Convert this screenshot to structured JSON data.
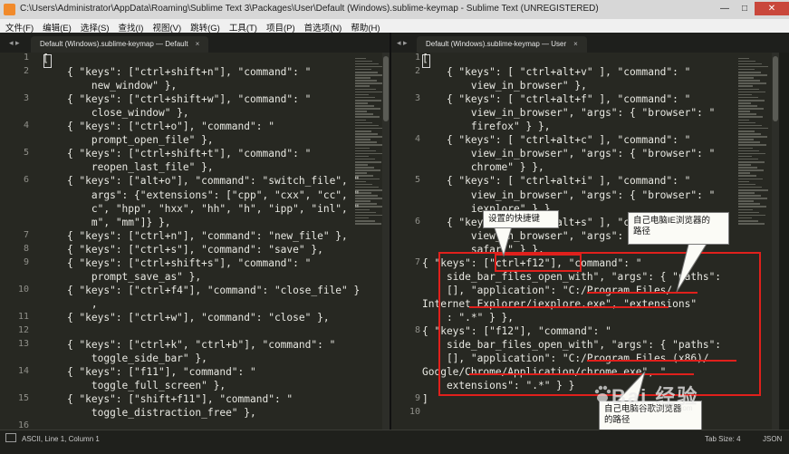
{
  "window": {
    "title": "C:\\Users\\Administrator\\AppData\\Roaming\\Sublime Text 3\\Packages\\User\\Default (Windows).sublime-keymap - Sublime Text (UNREGISTERED)",
    "minimize": "—",
    "maximize": "□",
    "close": "✕"
  },
  "menu": [
    "文件(F)",
    "编辑(E)",
    "选择(S)",
    "查找(I)",
    "视图(V)",
    "跳转(G)",
    "工具(T)",
    "项目(P)",
    "首选项(N)",
    "帮助(H)"
  ],
  "left_tab": {
    "label": "Default (Windows).sublime-keymap — Default",
    "close": "×",
    "nav": "◂ ▸"
  },
  "right_tab": {
    "label": "Default (Windows).sublime-keymap — User",
    "close": "×",
    "nav": "◂ ▸"
  },
  "left_lines": [
    {
      "n": "1",
      "text": "["
    },
    {
      "n": "2",
      "text": "    { \"keys\": [\"ctrl+shift+n\"], \"command\": \""
    },
    {
      "n": "",
      "text": "        new_window\" },"
    },
    {
      "n": "3",
      "text": "    { \"keys\": [\"ctrl+shift+w\"], \"command\": \""
    },
    {
      "n": "",
      "text": "        close_window\" },"
    },
    {
      "n": "4",
      "text": "    { \"keys\": [\"ctrl+o\"], \"command\": \""
    },
    {
      "n": "",
      "text": "        prompt_open_file\" },"
    },
    {
      "n": "5",
      "text": "    { \"keys\": [\"ctrl+shift+t\"], \"command\": \""
    },
    {
      "n": "",
      "text": "        reopen_last_file\" },"
    },
    {
      "n": "6",
      "text": "    { \"keys\": [\"alt+o\"], \"command\": \"switch_file\", \""
    },
    {
      "n": "",
      "text": "        args\": {\"extensions\": [\"cpp\", \"cxx\", \"cc\", \""
    },
    {
      "n": "",
      "text": "        c\", \"hpp\", \"hxx\", \"hh\", \"h\", \"ipp\", \"inl\", \""
    },
    {
      "n": "",
      "text": "        m\", \"mm\"]} },"
    },
    {
      "n": "7",
      "text": "    { \"keys\": [\"ctrl+n\"], \"command\": \"new_file\" },"
    },
    {
      "n": "8",
      "text": "    { \"keys\": [\"ctrl+s\"], \"command\": \"save\" },"
    },
    {
      "n": "9",
      "text": "    { \"keys\": [\"ctrl+shift+s\"], \"command\": \""
    },
    {
      "n": "",
      "text": "        prompt_save_as\" },"
    },
    {
      "n": "10",
      "text": "    { \"keys\": [\"ctrl+f4\"], \"command\": \"close_file\" }"
    },
    {
      "n": "",
      "text": "        ,"
    },
    {
      "n": "11",
      "text": "    { \"keys\": [\"ctrl+w\"], \"command\": \"close\" },"
    },
    {
      "n": "12",
      "text": ""
    },
    {
      "n": "13",
      "text": "    { \"keys\": [\"ctrl+k\", \"ctrl+b\"], \"command\": \""
    },
    {
      "n": "",
      "text": "        toggle_side_bar\" },"
    },
    {
      "n": "14",
      "text": "    { \"keys\": [\"f11\"], \"command\": \""
    },
    {
      "n": "",
      "text": "        toggle_full_screen\" },"
    },
    {
      "n": "15",
      "text": "    { \"keys\": [\"shift+f11\"], \"command\": \""
    },
    {
      "n": "",
      "text": "        toggle_distraction_free\" },"
    },
    {
      "n": "16",
      "text": ""
    }
  ],
  "right_lines": [
    {
      "n": "1",
      "text": "["
    },
    {
      "n": "2",
      "text": "    { \"keys\": [ \"ctrl+alt+v\" ], \"command\": \""
    },
    {
      "n": "",
      "text": "        view_in_browser\" },"
    },
    {
      "n": "3",
      "text": "    { \"keys\": [ \"ctrl+alt+f\" ], \"command\": \""
    },
    {
      "n": "",
      "text": "        view_in_browser\", \"args\": { \"browser\": \""
    },
    {
      "n": "",
      "text": "        firefox\" } },"
    },
    {
      "n": "4",
      "text": "    { \"keys\": [ \"ctrl+alt+c\" ], \"command\": \""
    },
    {
      "n": "",
      "text": "        view_in_browser\", \"args\": { \"browser\": \""
    },
    {
      "n": "",
      "text": "        chrome\" } },"
    },
    {
      "n": "5",
      "text": "    { \"keys\": [ \"ctrl+alt+i\" ], \"command\": \""
    },
    {
      "n": "",
      "text": "        view_in_browser\", \"args\": { \"browser\": \""
    },
    {
      "n": "",
      "text": "        iexplore\" } },"
    },
    {
      "n": "6",
      "text": "    { \"keys\": [ \"ctrl+alt+s\" ], \"command\": \""
    },
    {
      "n": "",
      "text": "        view_in_browser\", \"args\": { \"browser\": \""
    },
    {
      "n": "",
      "text": "        safari\" } },"
    },
    {
      "n": "7",
      "text": "{ \"keys\": [\"ctrl+f12\"], \"command\": \""
    },
    {
      "n": "",
      "text": "    side_bar_files_open_with\", \"args\": { \"paths\":"
    },
    {
      "n": "",
      "text": "    [], \"application\": \"C:/Program Files/"
    },
    {
      "n": "",
      "text": "Internet Explorer/iexplore.exe\", \"extensions\""
    },
    {
      "n": "",
      "text": "    : \".*\" } },"
    },
    {
      "n": "8",
      "text": "{ \"keys\": [\"f12\"], \"command\": \""
    },
    {
      "n": "",
      "text": "    side_bar_files_open_with\", \"args\": { \"paths\":"
    },
    {
      "n": "",
      "text": "    [], \"application\": \"C:/Program Files (x86)/"
    },
    {
      "n": "",
      "text": "Google/Chrome/Application/chrome.exe\", \""
    },
    {
      "n": "",
      "text": "    extensions\": \".*\" } }"
    },
    {
      "n": "9",
      "text": "]"
    },
    {
      "n": "10",
      "text": ""
    }
  ],
  "annotations": {
    "shortcut_label": "设置的快捷键",
    "ie_label_line1": "自己电脑IE浏览器的",
    "ie_label_line2": "路径",
    "chrome_label_line1": "自己电脑谷歌浏览器",
    "chrome_label_line2": "的路径"
  },
  "status": {
    "left": "ASCII, Line 1, Column 1",
    "tab_size": "Tab Size: 4",
    "syntax": "JSON"
  },
  "watermark": {
    "text": "Bai 经验",
    "url": "jingyan.baidu.com"
  },
  "colors": {
    "editor_bg": "#272822",
    "highlight_red": "#e0201c"
  }
}
